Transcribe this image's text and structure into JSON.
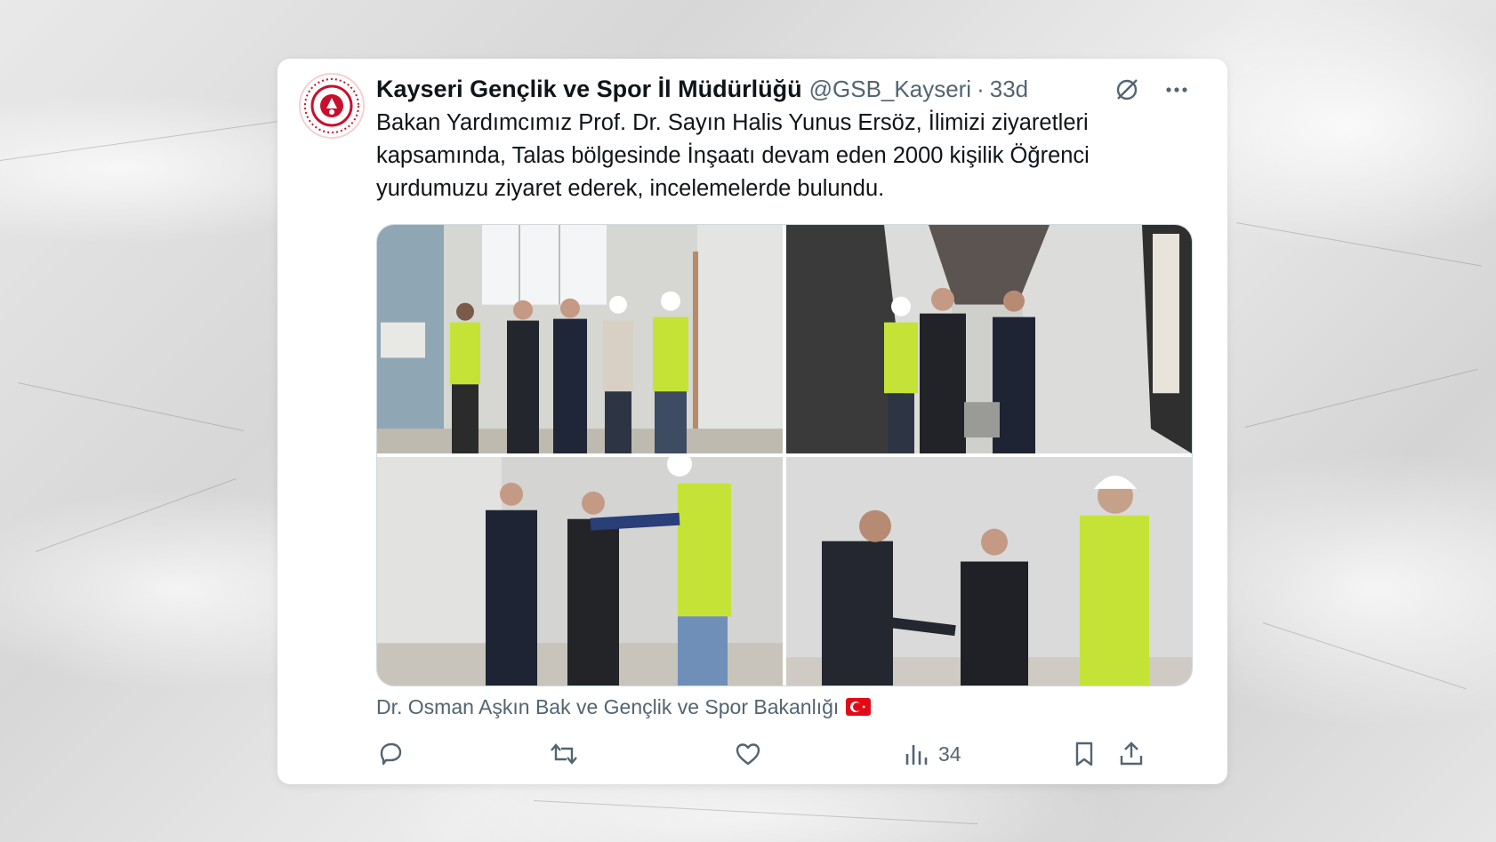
{
  "tweet": {
    "author_name": "Kayseri Gençlik ve Spor İl Müdürlüğü",
    "handle": "@GSB_Kayseri",
    "separator": "·",
    "time": "33d",
    "text": "Bakan Yardımcımız Prof. Dr. Sayın Halis Yunus Ersöz, İlimizi ziyaretleri kapsamında, Talas bölgesinde İnşaatı devam eden 2000 kişilik Öğrenci yurdumuzu ziyaret ederek, incelemelerde bulundu.",
    "photos": [
      {
        "icon": "photo-group-in-hallway"
      },
      {
        "icon": "photo-walking-corridor"
      },
      {
        "icon": "photo-pointing-worker"
      },
      {
        "icon": "photo-handshake"
      }
    ],
    "caption": "Dr. Osman Aşkın Bak ve Gençlik ve Spor Bakanlığı",
    "caption_flag": "turkey-flag-icon",
    "views": "34"
  },
  "colors": {
    "text": "#0f1419",
    "secondary": "#536471",
    "flag_red": "#e30a17",
    "avatar_red": "#c8102e"
  }
}
